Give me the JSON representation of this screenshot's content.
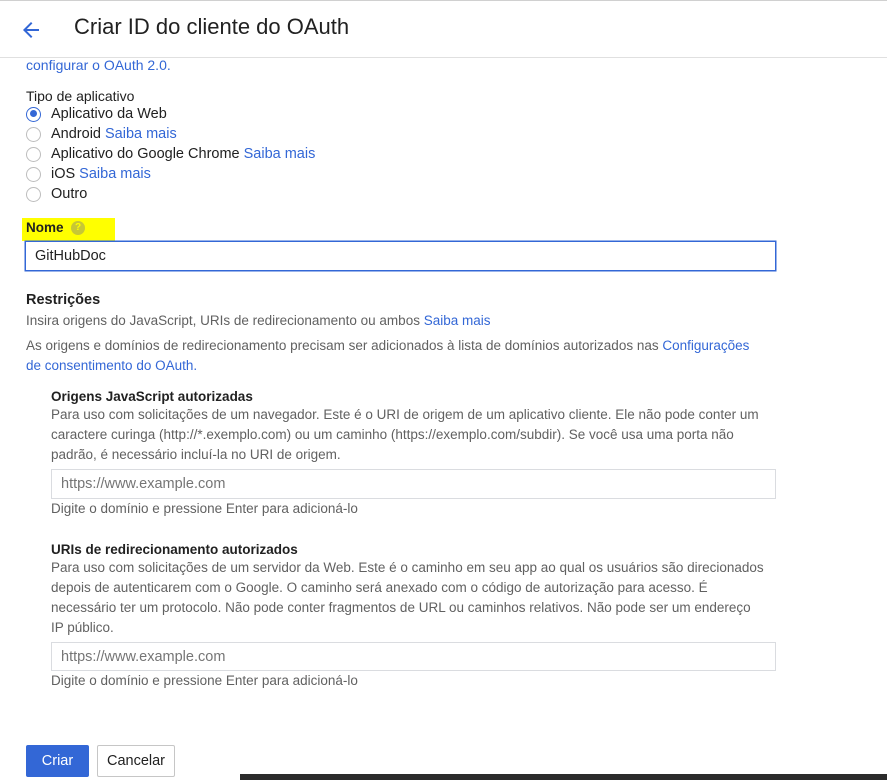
{
  "header": {
    "title": "Criar ID do cliente do OAuth",
    "back_icon": "arrow-back-icon"
  },
  "intro_link": "configurar o OAuth 2.0.",
  "app_type": {
    "label": "Tipo de aplicativo",
    "options": [
      {
        "label": "Aplicativo da Web",
        "link": "",
        "checked": true
      },
      {
        "label": "Android",
        "link": "Saiba mais",
        "checked": false
      },
      {
        "label": "Aplicativo do Google Chrome",
        "link": "Saiba mais",
        "checked": false
      },
      {
        "label": "iOS",
        "link": "Saiba mais",
        "checked": false
      },
      {
        "label": "Outro",
        "link": "",
        "checked": false
      }
    ]
  },
  "name_field": {
    "label": "Nome",
    "help_icon": "help-icon",
    "value": "GitHubDoc"
  },
  "restrictions": {
    "title": "Restrições",
    "description": "Insira origens do JavaScript, URIs de redirecionamento ou ambos",
    "description_link": "Saiba mais",
    "notice_line1": "As origens e domínios de redirecionamento precisam ser adicionados à lista de domínios autorizados nas",
    "notice_link_part1": "Configurações",
    "notice_link_part2": "de consentimento do OAuth."
  },
  "js_origins": {
    "title": "Origens JavaScript autorizadas",
    "desc_lines": [
      "Para uso com solicitações de um navegador. Este é o URI de origem de um aplicativo cliente. Ele não pode conter um",
      "caractere curinga (http://*.exemplo.com) ou um caminho (https://exemplo.com/subdir). Se você usa uma porta não",
      "padrão, é necessário incluí-la no URI de origem."
    ],
    "placeholder": "https://www.example.com",
    "hint": "Digite o domínio e pressione Enter para adicioná-lo"
  },
  "redirect_uris": {
    "title": "URIs de redirecionamento autorizados",
    "desc_lines": [
      "Para uso com solicitações de um servidor da Web. Este é o caminho em seu app ao qual os usuários são direcionados",
      "depois de autenticarem com o Google. O caminho será anexado com o código de autorização para acesso. É",
      "necessário ter um protocolo. Não pode conter fragmentos de URL ou caminhos relativos. Não pode ser um endereço",
      "IP público."
    ],
    "placeholder": "https://www.example.com",
    "hint": "Digite o domínio e pressione Enter para adicioná-lo"
  },
  "actions": {
    "create": "Criar",
    "cancel": "Cancelar"
  },
  "colors": {
    "accent": "#3367d6",
    "highlight": "#ffff00"
  }
}
